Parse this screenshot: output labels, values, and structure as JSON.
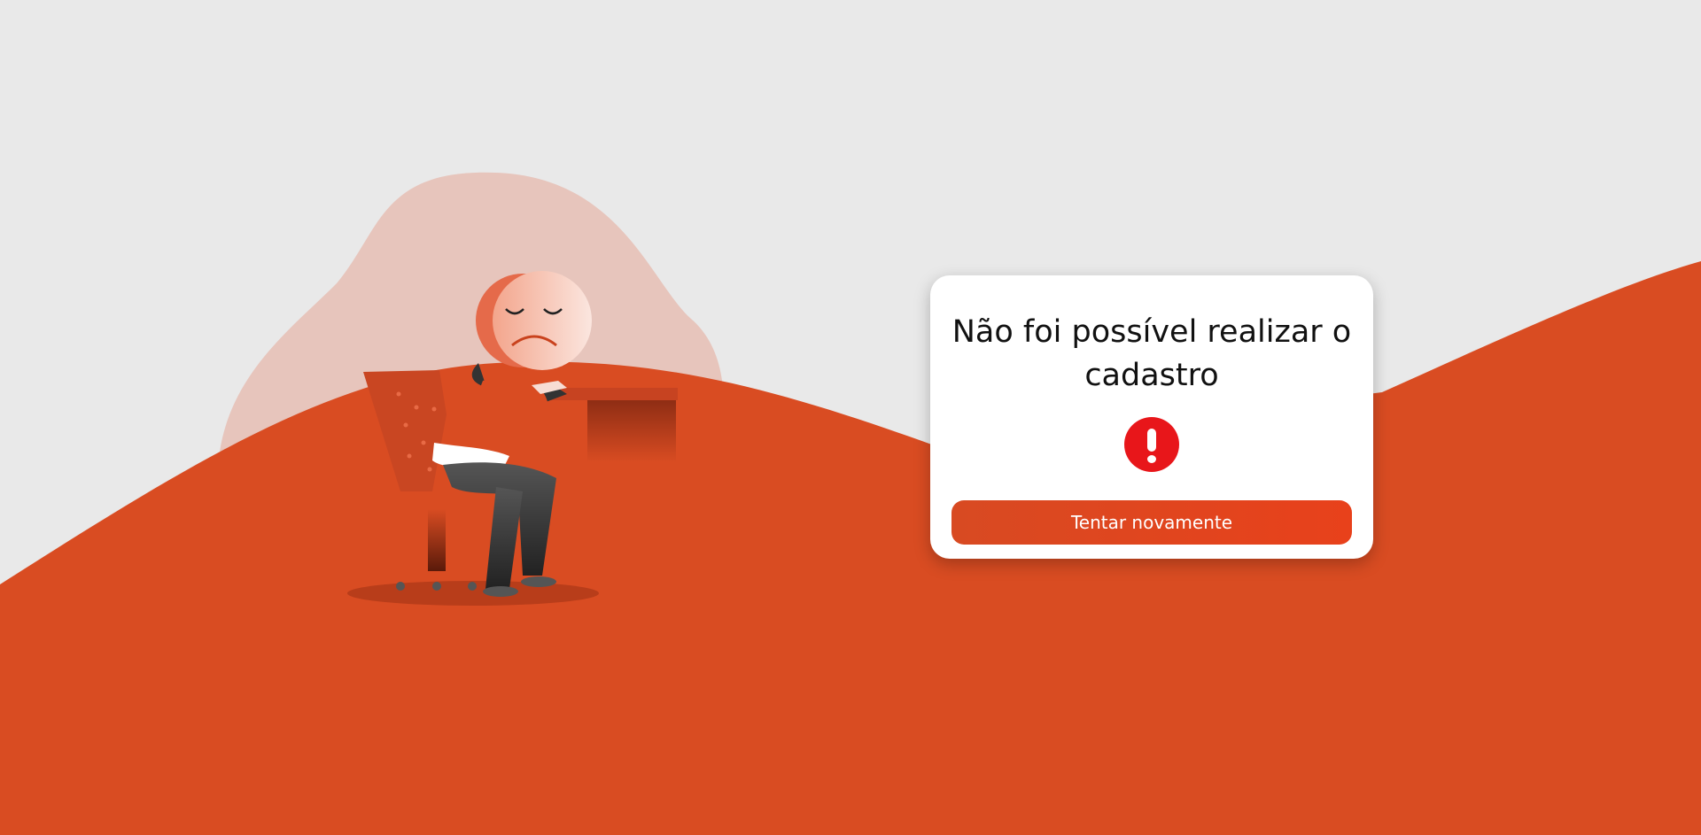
{
  "dialog": {
    "title": "Não foi possível realizar o cadastro",
    "button_label": "Tentar novamente",
    "alert_icon": "exclamation-circle-icon"
  },
  "colors": {
    "background": "#e9e9e9",
    "hill": "#d94c22",
    "blob": "#e7c5bc",
    "alert": "#e8161a",
    "button": "#e0461f"
  },
  "illustration": "sad-person-at-desk"
}
